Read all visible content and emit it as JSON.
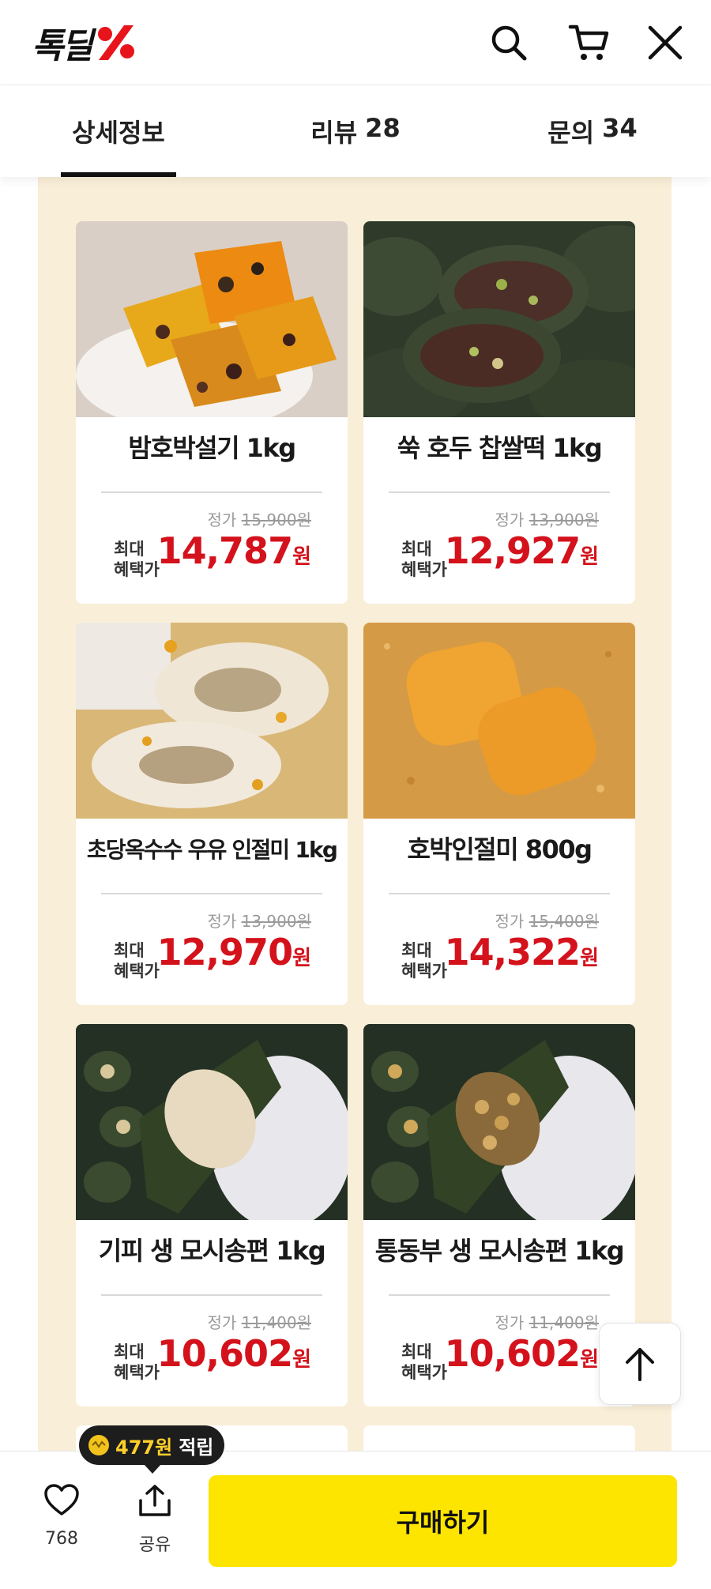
{
  "header": {
    "logo_text": "톡딜",
    "logo_mark_color": "#e8141c"
  },
  "tabs": [
    {
      "label": "상세정보",
      "count": ""
    },
    {
      "label": "리뷰",
      "count": "28"
    },
    {
      "label": "문의",
      "count": "34"
    }
  ],
  "products": [
    {
      "name": "밤호박설기 1kg",
      "orig_label": "정가",
      "orig_price": "15,900원",
      "max_label_1": "최대",
      "max_label_2": "혜택가",
      "sale_price": "14,787",
      "won": "원"
    },
    {
      "name": "쑥 호두 찹쌀떡 1kg",
      "orig_label": "정가",
      "orig_price": "13,900원",
      "max_label_1": "최대",
      "max_label_2": "혜택가",
      "sale_price": "12,927",
      "won": "원"
    },
    {
      "name": "초당옥수수 우유 인절미 1kg",
      "orig_label": "정가",
      "orig_price": "13,900원",
      "max_label_1": "최대",
      "max_label_2": "혜택가",
      "sale_price": "12,970",
      "won": "원"
    },
    {
      "name": "호박인절미 800g",
      "orig_label": "정가",
      "orig_price": "15,400원",
      "max_label_1": "최대",
      "max_label_2": "혜택가",
      "sale_price": "14,322",
      "won": "원"
    },
    {
      "name": "기피 생 모시송편 1kg",
      "orig_label": "정가",
      "orig_price": "11,400원",
      "max_label_1": "최대",
      "max_label_2": "혜택가",
      "sale_price": "10,602",
      "won": "원"
    },
    {
      "name": "통동부 생 모시송편 1kg",
      "orig_label": "정가",
      "orig_price": "11,400원",
      "max_label_1": "최대",
      "max_label_2": "혜택가",
      "sale_price": "10,602",
      "won": "원"
    }
  ],
  "points_badge": {
    "amount": "477원",
    "text": "적립"
  },
  "bottom_bar": {
    "like_count": "768",
    "share_label": "공유",
    "buy_label": "구매하기"
  },
  "colors": {
    "accent_red": "#d4121c",
    "buy_yellow": "#fde500",
    "content_bg": "#f9eed7"
  },
  "icons": [
    "search-icon",
    "cart-icon",
    "close-icon",
    "arrow-up-icon",
    "heart-icon",
    "share-icon",
    "coin-icon"
  ]
}
